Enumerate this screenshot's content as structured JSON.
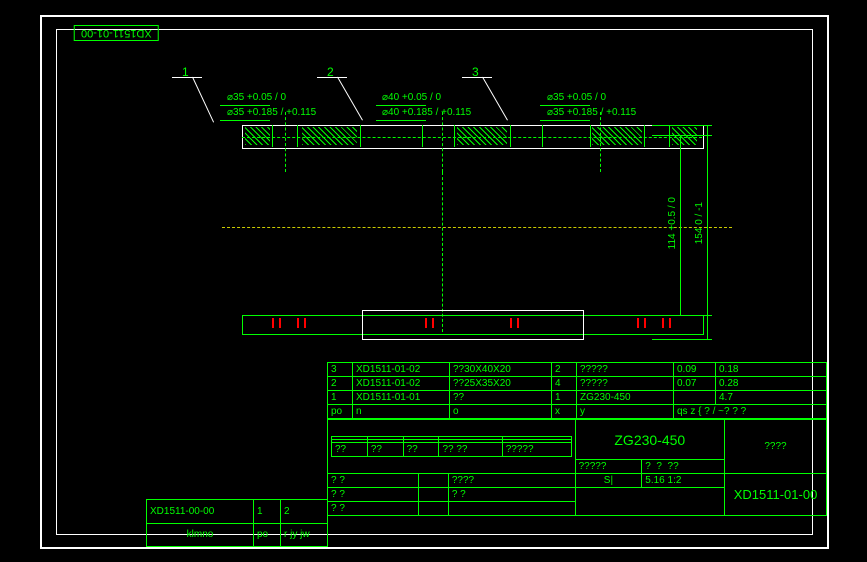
{
  "header": {
    "drawing_number_flipped": "XD1511-01-00"
  },
  "leaders": {
    "one": "1",
    "two": "2",
    "three": "3"
  },
  "dimensions": {
    "d35_upper": "⌀35 +0.05 / 0",
    "d35_lower": "⌀35 +0.185 / +0.115",
    "d40_upper": "⌀40 +0.05 / 0",
    "d40_lower": "⌀40 +0.185 / +0.115",
    "d35_r_upper": "⌀35 +0.05 / 0",
    "d35_r_lower": "⌀35 +0.185 / +0.115",
    "h114": "114 +0.5 / 0",
    "h154": "154 0 / -1"
  },
  "bom": {
    "rows": [
      {
        "n": "3",
        "code": "XD1511-01-02",
        "spec": "??30X40X20",
        "q": "2",
        "note": "?????",
        "w1": "0.09",
        "w2": "0.18"
      },
      {
        "n": "2",
        "code": "XD1511-01-02",
        "spec": "??25X35X20",
        "q": "4",
        "note": "?????",
        "w1": "0.07",
        "w2": "0.28"
      },
      {
        "n": "1",
        "code": "XD1511-01-01",
        "spec": "??",
        "q": "1",
        "note": "ZG230-450",
        "w1": "",
        "w2": "4.7"
      }
    ],
    "headers": {
      "c1": "po",
      "c2": "n",
      "c3": "o",
      "c4": "x",
      "c5": "y",
      "c6": "qs",
      "c7": "z",
      "c8": "{",
      "c9": "? / ~?",
      "c10": "?  ?"
    }
  },
  "titleblock": {
    "material": "ZG230-450",
    "mass_header": "????",
    "mass": "?????",
    "scale_label": "S|",
    "scale": "5.16",
    "ratio": "1:2",
    "proj": "????",
    "drawing_no": "XD1511-01-00",
    "rev": "?",
    "rev2": "?",
    "rev3": "??",
    "q1": "??",
    "q2": "??",
    "q3": "??",
    "q4": "?? ??",
    "q5": "?????",
    "r1": "? ?",
    "r2": "? ?",
    "r3": "? ?",
    "r4": "????",
    "r5": "? ?"
  },
  "sideblock": {
    "code": "XD1511-00-00",
    "n1": "1",
    "n2": "2",
    "name": "klmno",
    "c1": "po",
    "c2": "r jy",
    "c3": "jw"
  }
}
